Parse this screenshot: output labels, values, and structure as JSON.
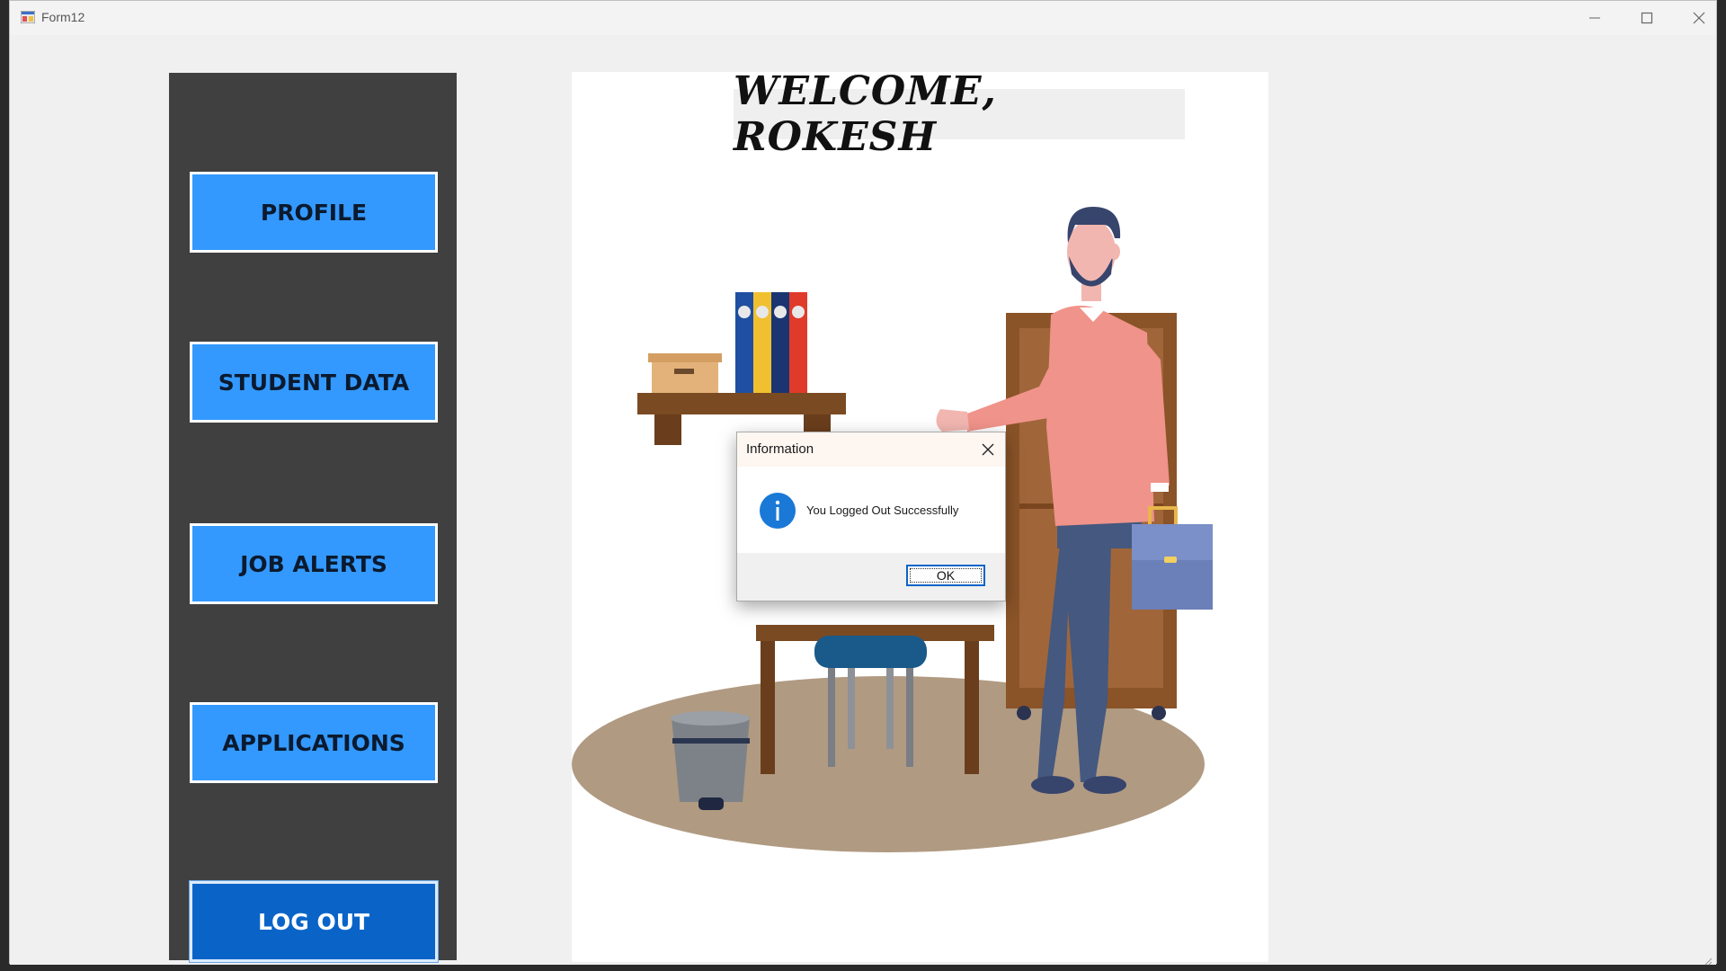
{
  "window": {
    "title": "Form12",
    "app_icon": "winforms-app-icon",
    "controls": {
      "minimize": "minimize-icon",
      "maximize": "maximize-icon",
      "close": "close-icon"
    }
  },
  "nav": {
    "buttons": [
      {
        "label": "PROFILE"
      },
      {
        "label": "STUDENT DATA"
      },
      {
        "label": "JOB ALERTS"
      },
      {
        "label": "APPLICATIONS"
      },
      {
        "label": "LOG OUT"
      }
    ]
  },
  "main": {
    "welcome": "WELCOME, ROKESH",
    "illustration": "office-man-with-briefcase-illustration"
  },
  "dialog": {
    "title": "Information",
    "message": "You Logged Out Successfully",
    "icon": "info-icon",
    "ok_label": "OK"
  },
  "colors": {
    "nav_panel": "#404040",
    "nav_button": "#3399ff",
    "logout_button": "#0a64c8",
    "info_icon": "#1a78d6"
  }
}
